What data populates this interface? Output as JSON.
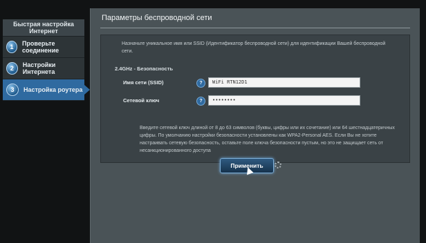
{
  "sidebar": {
    "header": "Быстрая настройка Интернет",
    "items": [
      {
        "num": "1",
        "label": "Проверьте соединение",
        "active": false
      },
      {
        "num": "2",
        "label": "Настройки Интернета",
        "active": false
      },
      {
        "num": "3",
        "label": "Настройка роутера",
        "active": true
      }
    ]
  },
  "main": {
    "title": "Параметры беспроводной сети",
    "description": "Назначьте уникальное имя или SSID (Идентификатор беспроводной сети) для идентификации Вашей беспроводной сети.",
    "band_label": "2.4GHz - Безопасность",
    "ssid_label": "Имя сети (SSID)",
    "ssid_value": "WiFi RTN12D1",
    "key_label": "Сетевой ключ",
    "key_value": "••••••••",
    "help_icon": "?",
    "note": "Введите сетевой ключ длиной от 8 до 63 символов (буквы, цифры или их сочетание) или 64 шестнадцатеричных цифры. По умолчанию настройки безопасности установлены как WPA2-Personal AES. Если Вы не хотите настраивать сетевую безопасность, оставьте поле ключа безопасности пустым, но это не защищает сеть от несанкционированного доступа",
    "apply_label": "Применить"
  },
  "colors": {
    "accent": "#2f6aa0",
    "panel": "#4a5357"
  }
}
